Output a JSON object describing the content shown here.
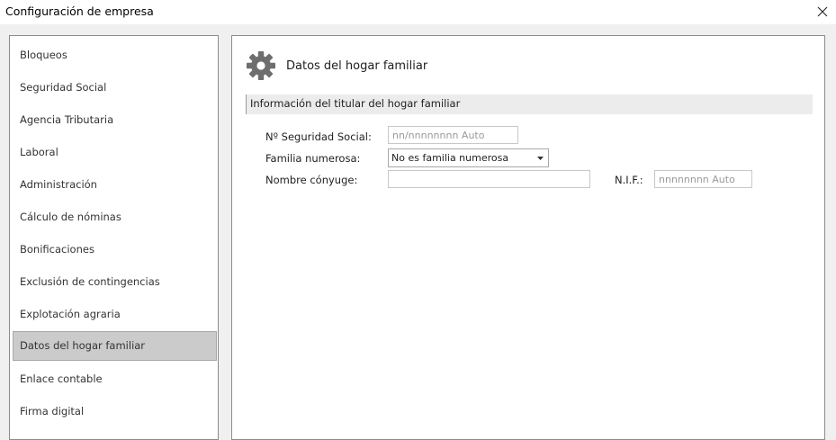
{
  "window": {
    "title": "Configuración de empresa"
  },
  "sidebar": {
    "items": [
      {
        "label": "Bloqueos"
      },
      {
        "label": "Seguridad Social"
      },
      {
        "label": "Agencia Tributaria"
      },
      {
        "label": "Laboral"
      },
      {
        "label": "Administración"
      },
      {
        "label": "Cálculo de nóminas"
      },
      {
        "label": "Bonificaciones"
      },
      {
        "label": "Exclusión de contingencias"
      },
      {
        "label": "Explotación agraria"
      },
      {
        "label": "Datos del hogar familiar"
      },
      {
        "label": "Enlace contable"
      },
      {
        "label": "Firma digital"
      }
    ],
    "selected_index": 9
  },
  "main": {
    "icon": "gear-icon",
    "section_title": "Datos del hogar familiar",
    "group_title": "Información del titular del hogar familiar",
    "fields": {
      "nss": {
        "label": "Nº Seguridad Social:",
        "value": "",
        "placeholder": "nn/nnnnnnnn Auto"
      },
      "familia": {
        "label": "Familia numerosa:",
        "value": "No es familia numerosa"
      },
      "conyuge": {
        "label": "Nombre cónyuge:",
        "value": "",
        "placeholder": ""
      },
      "nif": {
        "label": "N.I.F.:",
        "value": "",
        "placeholder": "nnnnnnnn Auto"
      }
    }
  },
  "colors": {
    "selected_item_bg": "#cbcbcb",
    "group_bar_bg": "#ececec",
    "window_bg": "#f0f0f0"
  }
}
